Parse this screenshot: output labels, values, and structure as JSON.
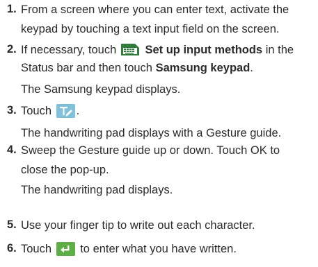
{
  "steps": [
    {
      "number": "1.",
      "lines": [
        "From a screen where you can enter text, activate the",
        "keypad by touching a text input field on the screen."
      ]
    },
    {
      "number": "2.",
      "line1_pre": "If necessary, touch",
      "line1_bold": "Set up input methods",
      "line1_post": "in the",
      "line2_pre": "Status bar and then touch",
      "line2_bold": "Samsung keypad",
      "line2_post": ".",
      "result": "The Samsung keypad displays.",
      "icon": "keyboard-grid-icon"
    },
    {
      "number": "3.",
      "line1_pre": "Touch",
      "line1_post": ".",
      "result": "The handwriting pad displays with a Gesture guide.",
      "icon": "handwriting-t-pen-icon"
    },
    {
      "number": "4.",
      "lines": [
        "Sweep the Gesture guide up or down. Touch OK to",
        "close the pop-up."
      ],
      "result": "The handwriting pad displays."
    },
    {
      "number": "5.",
      "lines": [
        "Use your finger tip to write out each character."
      ]
    },
    {
      "number": "6.",
      "line1_pre": "Touch",
      "line1_post": "to enter what you have written.",
      "icon": "enter-key-icon"
    }
  ],
  "colors": {
    "text": "#2b2b2b",
    "keypad_icon_bg": "#2e7d3a",
    "t_icon_bg": "#7fc0da",
    "enter_icon_bg": "#5cae45"
  }
}
